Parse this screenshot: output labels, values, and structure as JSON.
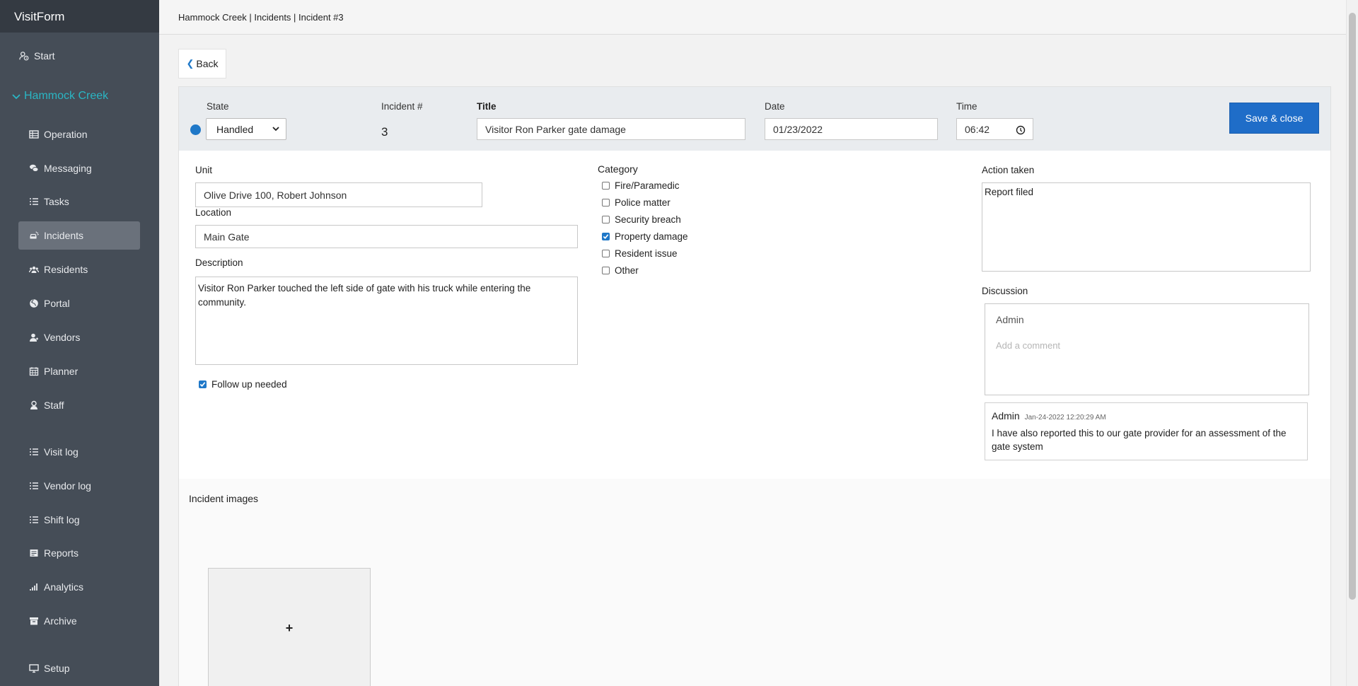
{
  "app": {
    "name": "VisitForm"
  },
  "sidebar": {
    "start_label": "Start",
    "community": "Hammock Creek",
    "items": [
      {
        "label": "Operation",
        "icon": "table-icon"
      },
      {
        "label": "Messaging",
        "icon": "chat-icon"
      },
      {
        "label": "Tasks",
        "icon": "list-icon"
      },
      {
        "label": "Incidents",
        "icon": "car-crash-icon",
        "active": true
      },
      {
        "label": "Residents",
        "icon": "users-icon"
      },
      {
        "label": "Portal",
        "icon": "globe-icon"
      },
      {
        "label": "Vendors",
        "icon": "vendor-icon"
      },
      {
        "label": "Planner",
        "icon": "calendar-icon"
      },
      {
        "label": "Staff",
        "icon": "staff-icon"
      },
      {
        "label": "Visit log",
        "icon": "list-icon"
      },
      {
        "label": "Vendor log",
        "icon": "list-icon"
      },
      {
        "label": "Shift log",
        "icon": "list-icon"
      },
      {
        "label": "Reports",
        "icon": "report-icon"
      },
      {
        "label": "Analytics",
        "icon": "bar-chart-icon"
      },
      {
        "label": "Archive",
        "icon": "archive-icon"
      },
      {
        "label": "Setup",
        "icon": "monitor-icon"
      }
    ]
  },
  "topbar": {
    "breadcrumb": "Hammock Creek | Incidents | Incident #3"
  },
  "back_label": "Back",
  "header": {
    "state_label": "State",
    "state_value": "Handled",
    "state_color": "#1f78c8",
    "incident_num_label": "Incident #",
    "incident_num": "3",
    "title_label": "Title",
    "title_value": "Visitor Ron Parker gate damage",
    "date_label": "Date",
    "date_value": "01/23/2022",
    "time_label": "Time",
    "time_value": "06:42",
    "save_label": "Save & close"
  },
  "form": {
    "unit_label": "Unit",
    "unit_value": "Olive Drive 100, Robert Johnson",
    "location_label": "Location",
    "location_value": "Main Gate",
    "description_label": "Description",
    "description_value": "Visitor Ron Parker touched the left side of gate with his truck while entering the community.",
    "follow_up_label": "Follow up needed",
    "follow_up_checked": true
  },
  "category": {
    "label": "Category",
    "options": [
      {
        "label": "Fire/Paramedic",
        "checked": false
      },
      {
        "label": "Police matter",
        "checked": false
      },
      {
        "label": "Security breach",
        "checked": false
      },
      {
        "label": "Property damage",
        "checked": true
      },
      {
        "label": "Resident issue",
        "checked": false
      },
      {
        "label": "Other",
        "checked": false
      }
    ]
  },
  "action": {
    "label": "Action taken",
    "value": "Report filed"
  },
  "discussion": {
    "label": "Discussion",
    "user": "Admin",
    "placeholder": "Add a comment",
    "comments": [
      {
        "author": "Admin",
        "time": "Jan-24-2022 12:20:29 AM",
        "text": "I have also reported this to our gate provider for an assessment of the gate system"
      }
    ]
  },
  "images": {
    "label": "Incident images",
    "add_symbol": "+"
  }
}
